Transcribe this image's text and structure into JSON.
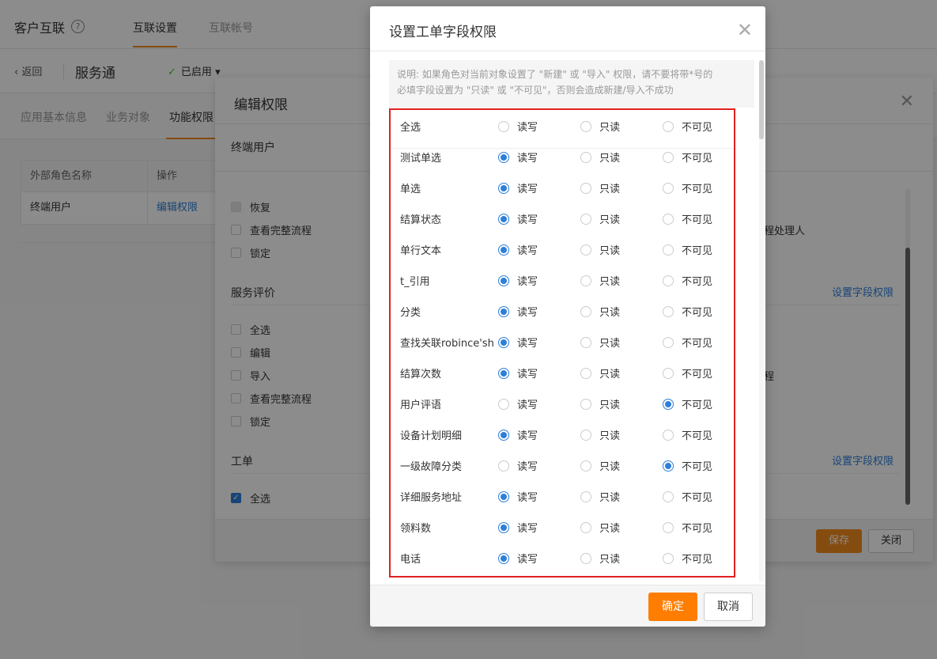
{
  "header": {
    "app_title": "客户互联",
    "help_icon": "?",
    "tabs": [
      {
        "label": "互联设置"
      },
      {
        "label": "互联帐号"
      }
    ]
  },
  "subheader": {
    "back_label": "返回",
    "service_name": "服务通",
    "status_label": "已启用"
  },
  "page_tabs": [
    {
      "label": "应用基本信息"
    },
    {
      "label": "业务对象"
    },
    {
      "label": "功能权限"
    }
  ],
  "role_table": {
    "columns": [
      "外部角色名称",
      "操作"
    ],
    "rows": [
      {
        "name": "终端用户",
        "action": "编辑权限"
      }
    ]
  },
  "edit_panel": {
    "title": "编辑权限",
    "role_name": "终端用户",
    "top_items": [
      "恢复",
      "查看完整流程",
      "锁定"
    ],
    "right_text_1": "程处理人",
    "right_text_2": "程",
    "set_field_link": "设置字段权限",
    "section_review": "服务评价",
    "review_items": [
      "全选",
      "编辑",
      "导入",
      "查看完整流程",
      "锁定"
    ],
    "section_ticket": "工单",
    "ticket_items": [
      "全选"
    ],
    "save_label": "保存",
    "close_label": "关闭"
  },
  "modal": {
    "title": "设置工单字段权限",
    "notice_line1": "说明: 如果角色对当前对象设置了 \"新建\" 或 \"导入\" 权限，请不要将带*号的",
    "notice_line2": "必填字段设置为 \"只读\" 或 \"不可见\"，否则会造成新建/导入不成功",
    "options": [
      "读写",
      "只读",
      "不可见"
    ],
    "select_all_label": "全选",
    "select_all_value": "",
    "fields": [
      {
        "label": "测试单选",
        "value": "读写"
      },
      {
        "label": "单选",
        "value": "读写"
      },
      {
        "label": "结算状态",
        "value": "读写"
      },
      {
        "label": "单行文本",
        "value": "读写"
      },
      {
        "label": "t_引用",
        "value": "读写"
      },
      {
        "label": "分类",
        "value": "读写"
      },
      {
        "label": "查找关联robince'shi",
        "value": "读写"
      },
      {
        "label": "结算次数",
        "value": "读写"
      },
      {
        "label": "用户评语",
        "value": "不可见"
      },
      {
        "label": "设备计划明细",
        "value": "读写"
      },
      {
        "label": "一级故障分类",
        "value": "不可见"
      },
      {
        "label": "详细服务地址",
        "value": "读写"
      },
      {
        "label": "领料数",
        "value": "读写"
      },
      {
        "label": "电话",
        "value": "读写"
      }
    ],
    "ok_label": "确定",
    "cancel_label": "取消"
  }
}
